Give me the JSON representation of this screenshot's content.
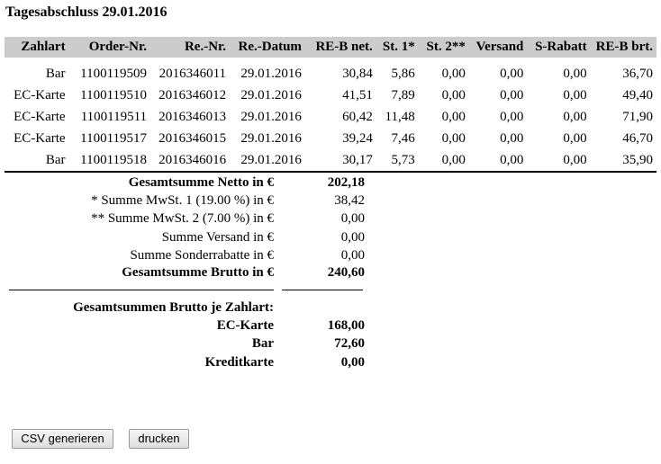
{
  "title": "Tagesabschluss 29.01.2016",
  "table": {
    "headers": [
      "Zahlart",
      "Order-Nr.",
      "Re.-Nr.",
      "Re.-Datum",
      "RE-B net.",
      "St. 1*",
      "St. 2**",
      "Versand",
      "S-Rabatt",
      "RE-B brt."
    ],
    "rows": [
      [
        "Bar",
        "1100119509",
        "2016346011",
        "29.01.2016",
        "30,84",
        "5,86",
        "0,00",
        "0,00",
        "0,00",
        "36,70"
      ],
      [
        "EC-Karte",
        "1100119510",
        "2016346012",
        "29.01.2016",
        "41,51",
        "7,89",
        "0,00",
        "0,00",
        "0,00",
        "49,40"
      ],
      [
        "EC-Karte",
        "1100119511",
        "2016346013",
        "29.01.2016",
        "60,42",
        "11,48",
        "0,00",
        "0,00",
        "0,00",
        "71,90"
      ],
      [
        "EC-Karte",
        "1100119517",
        "2016346015",
        "29.01.2016",
        "39,24",
        "7,46",
        "0,00",
        "0,00",
        "0,00",
        "46,70"
      ],
      [
        "Bar",
        "1100119518",
        "2016346016",
        "29.01.2016",
        "30,17",
        "5,73",
        "0,00",
        "0,00",
        "0,00",
        "35,90"
      ]
    ]
  },
  "summary": {
    "netto_label": "Gesamtsumme Netto in €",
    "netto_value": "202,18",
    "mwst1_label": "* Summe MwSt. 1 (19.00 %) in €",
    "mwst1_value": "38,42",
    "mwst2_label": "** Summe MwSt. 2 (7.00 %) in €",
    "mwst2_value": "0,00",
    "versand_label": "Summe Versand in €",
    "versand_value": "0,00",
    "rabatte_label": "Summe Sonderrabatte in €",
    "rabatte_value": "0,00",
    "brutto_label": "Gesamtsumme Brutto in €",
    "brutto_value": "240,60"
  },
  "by_payment": {
    "heading": "Gesamtsummen Brutto je Zahlart:",
    "items": [
      {
        "label": "EC-Karte",
        "value": "168,00"
      },
      {
        "label": "Bar",
        "value": "72,60"
      },
      {
        "label": "Kreditkarte",
        "value": "0,00"
      }
    ]
  },
  "buttons": {
    "csv_label": "CSV generieren",
    "print_label": "drucken"
  }
}
